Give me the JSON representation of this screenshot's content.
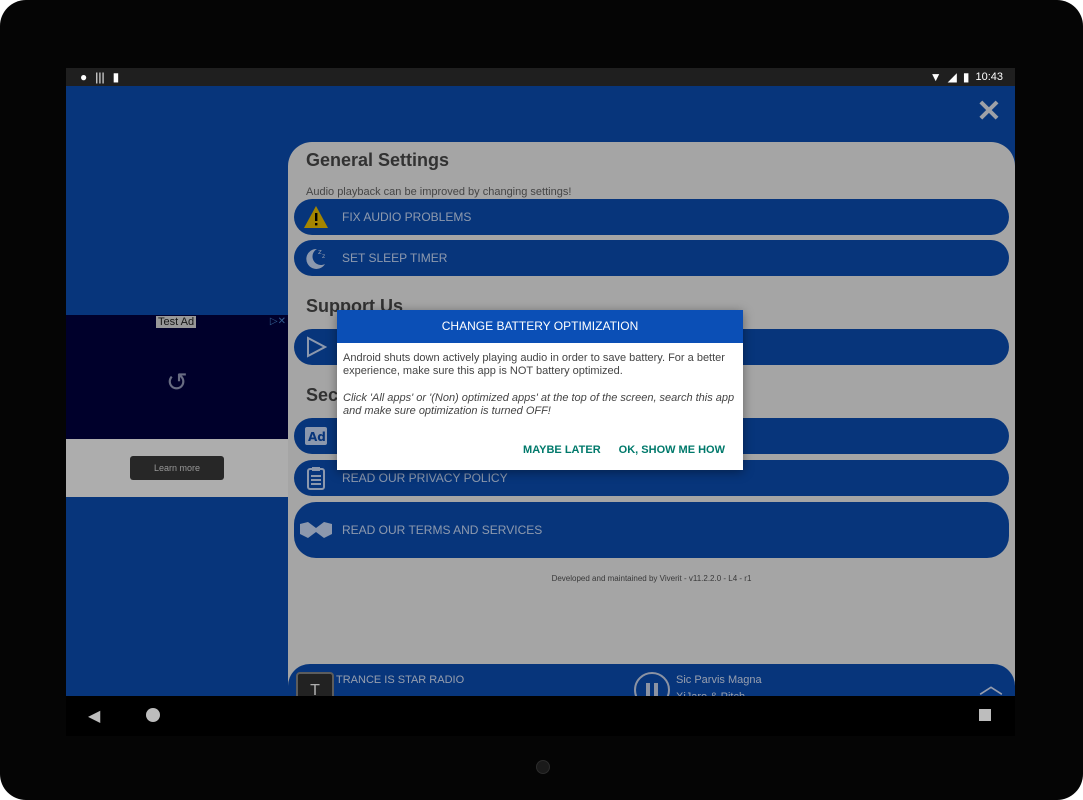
{
  "status": {
    "time": "10:43"
  },
  "app": {
    "close_icon": "close-icon",
    "general_title": "General Settings",
    "audio_note": "Audio playback can be improved by changing settings!",
    "buttons": [
      {
        "label": "FIX AUDIO PROBLEMS",
        "icon": "warning-icon"
      },
      {
        "label": "SET SLEEP TIMER",
        "icon": "sleep-icon"
      },
      {
        "label": "",
        "icon": "play-store-icon"
      },
      {
        "label": "",
        "icon": "ad-icon"
      },
      {
        "label": "READ OUR PRIVACY POLICY",
        "icon": "clipboard-icon"
      },
      {
        "label": "READ OUR TERMS AND SERVICES",
        "icon": "handshake-icon"
      }
    ],
    "support_title": "Support Us",
    "sec_title": "Sec",
    "developed": "Developed and maintained by Viverit - v11.2.2.0 - L4 - r1"
  },
  "ad": {
    "label": "Test Ad",
    "learn_more": "Learn more"
  },
  "player": {
    "station": "TRANCE IS STAR RADIO",
    "song": "Sic Parvis Magna",
    "artist": "XiJaro & Pitch"
  },
  "dialog": {
    "title": "CHANGE BATTERY OPTIMIZATION",
    "body1": "Android shuts down actively playing audio in order to save battery. For a better experience, make sure this app is NOT battery optimized.",
    "body2": "Click 'All apps' or '(Non) optimized apps' at the top of the screen, search this app and make sure optimization is turned OFF!",
    "maybe_later": "MAYBE LATER",
    "ok": "OK, SHOW ME HOW"
  },
  "colors": {
    "accent": "#0b4fb6",
    "dialog_action": "#00796b"
  }
}
